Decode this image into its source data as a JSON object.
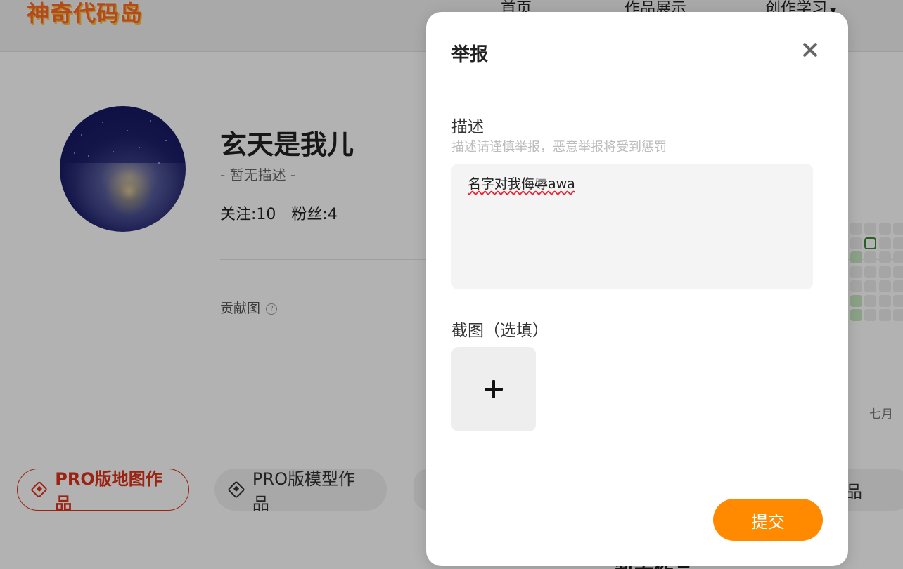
{
  "header": {
    "logo_text": "神奇代码岛",
    "nav": [
      {
        "label": "首页"
      },
      {
        "label": "作品展示"
      },
      {
        "label": "创作学习"
      }
    ]
  },
  "profile": {
    "username": "玄天是我儿",
    "bio": "- 暂无描述 -",
    "following": "关注:10",
    "followers": "粉丝:4",
    "contribution_label": "贡献图",
    "help_icon": "?",
    "month_label": "七月"
  },
  "tabs": [
    {
      "label": "PRO版地图作品"
    },
    {
      "label": "PRO版模型作品"
    },
    {
      "label": ""
    },
    {
      "label": "品"
    }
  ],
  "section_title": "暂无作品",
  "modal": {
    "title": "举报",
    "description_label": "描述",
    "description_hint": "描述请谨慎举报，恶意举报将受到惩罚",
    "description_value": "名字对我侮辱awa",
    "screenshot_label": "截图（选填）",
    "submit_label": "提交"
  },
  "colors": {
    "accent": "#ff8a00",
    "active_tab": "#e0321a",
    "contribution_green": "#c6e9c1"
  }
}
